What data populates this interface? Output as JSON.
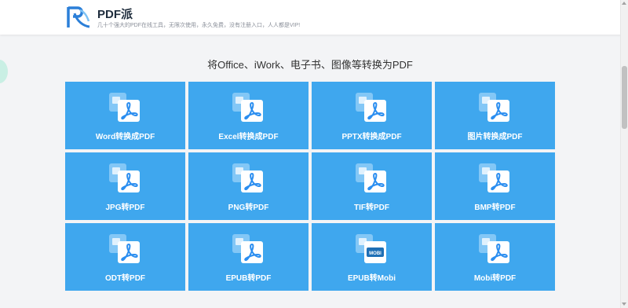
{
  "header": {
    "brand_name": "PDF派",
    "slogan": "几十个强大的PDF在线工具，无限次使用，永久免费，没有注册入口，人人都是VIP!"
  },
  "main": {
    "title": "将Office、iWork、电子书、图像等转换为PDF",
    "tiles": [
      {
        "label": "Word转换成PDF",
        "icon": "word-to-pdf-icon"
      },
      {
        "label": "Excel转换成PDF",
        "icon": "excel-to-pdf-icon"
      },
      {
        "label": "PPTX转换成PDF",
        "icon": "pptx-to-pdf-icon"
      },
      {
        "label": "图片转换成PDF",
        "icon": "image-to-pdf-icon"
      },
      {
        "label": "JPG转PDF",
        "icon": "jpg-to-pdf-icon"
      },
      {
        "label": "PNG转PDF",
        "icon": "png-to-pdf-icon"
      },
      {
        "label": "TIF转PDF",
        "icon": "tif-to-pdf-icon"
      },
      {
        "label": "BMP转PDF",
        "icon": "bmp-to-pdf-icon"
      },
      {
        "label": "ODT转PDF",
        "icon": "odt-to-pdf-icon"
      },
      {
        "label": "EPUB转PDF",
        "icon": "epub-to-pdf-icon"
      },
      {
        "label": "EPUB转Mobi",
        "icon": "epub-to-mobi-icon",
        "badge": "MOBI"
      },
      {
        "label": "Mobi转PDF",
        "icon": "mobi-to-pdf-icon"
      }
    ]
  },
  "colors": {
    "tile": "#3fa7ee",
    "brand": "#2b7fd8"
  }
}
